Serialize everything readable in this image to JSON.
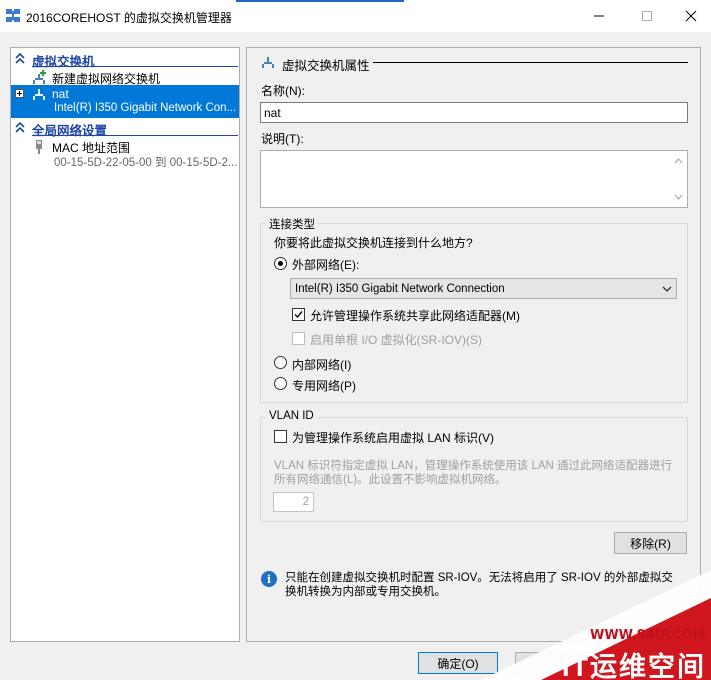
{
  "window": {
    "title": "2016COREHOST 的虚拟交换机管理器",
    "minimize_glyph": "—",
    "maximize_glyph": "☐",
    "close_glyph": "✕"
  },
  "sidebar": {
    "section_virtual_switches": "虚拟交换机",
    "new_switch": "新建虚拟网络交换机",
    "switch_name": "nat",
    "switch_adapter": "Intel(R) I350 Gigabit Network Con...",
    "section_global": "全局网络设置",
    "mac_range_title": "MAC 地址范围",
    "mac_range_value": "00-15-5D-22-05-00 到 00-15-5D-2..."
  },
  "props": {
    "header": "虚拟交换机属性",
    "name_label": "名称(N):",
    "name_value": "nat",
    "notes_label": "说明(T):",
    "connection_group": "连接类型",
    "connection_question": "你要将此虚拟交换机连接到什么地方?",
    "external_label": "外部网络(E):",
    "adapter_selected": "Intel(R) I350 Gigabit Network Connection",
    "allow_mgmt_label": "允许管理操作系统共享此网络适配器(M)",
    "sriov_label": "启用单根 I/O 虚拟化(SR-IOV)(S)",
    "internal_label": "内部网络(I)",
    "private_label": "专用网络(P)",
    "vlan_group": "VLAN ID",
    "vlan_enable_label": "为管理操作系统启用虚拟 LAN 标识(V)",
    "vlan_desc": "VLAN 标识符指定虚拟 LAN，管理操作系统使用该 LAN 通过此网络适配器进行所有网络通信(L)。此设置不影响虚拟机网络。",
    "vlan_value": "2",
    "remove_button": "移除(R)",
    "info_text": "只能在创建虚拟交换机时配置 SR-IOV。无法将启用了 SR-IOV 的外部虚拟交换机转换为内部或专用交换机。"
  },
  "footer": {
    "ok_button": "确定(O)"
  },
  "watermark": {
    "url": "WWW.94IP.COM",
    "brand": "IT运维空间"
  },
  "colors": {
    "accent": "#0078d7",
    "section_blue": "#1e46a5",
    "watermark_red": "#c0101b"
  }
}
